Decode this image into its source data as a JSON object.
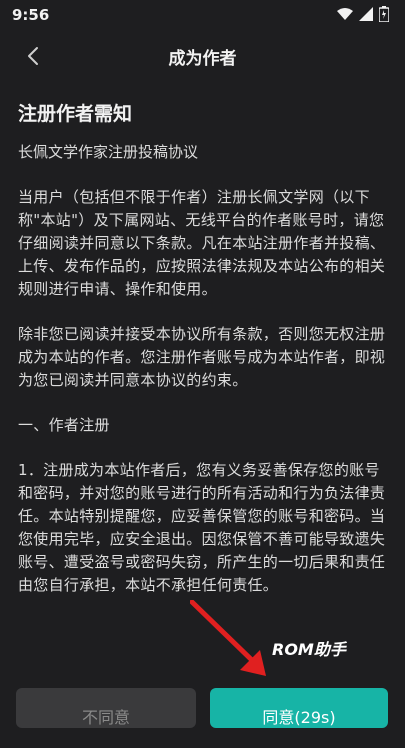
{
  "status_bar": {
    "time": "9:56"
  },
  "header": {
    "title": "成为作者"
  },
  "content": {
    "heading": "注册作者需知",
    "subtitle": "长佩文学作家注册投稿协议",
    "paragraphs": [
      "当用户（包括但不限于作者）注册长佩文学网（以下称\"本站\"）及下属网站、无线平台的作者账号时，请您仔细阅读并同意以下条款。凡在本站注册作者并投稿、上传、发布作品的，应按照法律法规及本站公布的相关规则进行申请、操作和使用。",
      "除非您已阅读并接受本协议所有条款，否则您无权注册成为本站的作者。您注册作者账号成为本站作者，即视为您已阅读并同意本协议的约束。",
      "一、作者注册",
      "1．注册成为本站作者后，您有义务妥善保存您的账号和密码，并对您的账号进行的所有活动和行为负法律责任。本站特别提醒您，应妥善保管您的账号和密码。当您使用完毕，应安全退出。因您保管不善可能导致遗失账号、遭受盗号或密码失窃，所产生的一切后果和责任由您自行承担，本站不承担任何责任。"
    ]
  },
  "buttons": {
    "decline": "不同意",
    "agree": "同意(29s)"
  },
  "watermark": "ROM助手",
  "colors": {
    "background": "#1e1e20",
    "accent": "#17b4a6",
    "annotation_arrow": "#e02020"
  }
}
